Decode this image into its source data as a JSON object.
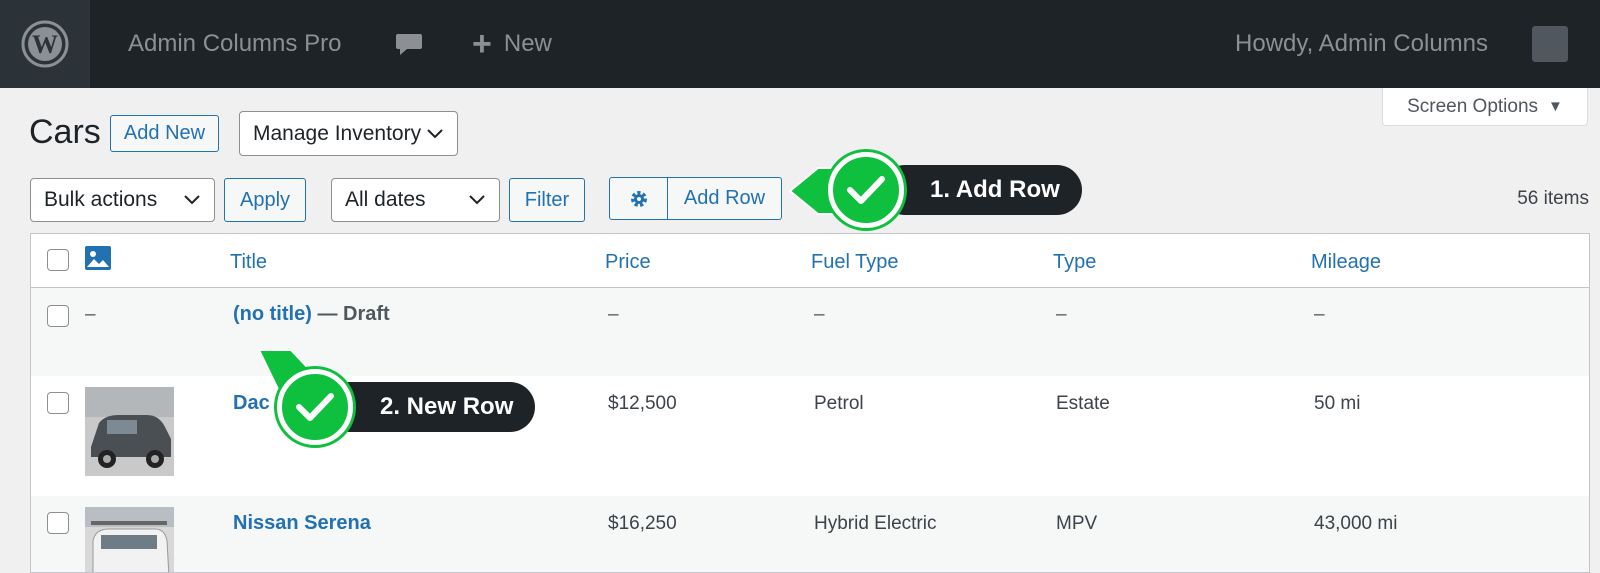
{
  "adminbar": {
    "site_name": "Admin Columns Pro",
    "new_label": "New",
    "howdy": "Howdy,  Admin Columns"
  },
  "screen_options": {
    "label": "Screen Options"
  },
  "page": {
    "title": "Cars",
    "add_new": "Add New",
    "manage_inventory": "Manage Inventory"
  },
  "toolbar": {
    "bulk_actions": "Bulk actions",
    "apply": "Apply",
    "all_dates": "All dates",
    "filter": "Filter",
    "add_row": "Add Row",
    "items_count": "56 items"
  },
  "table": {
    "headers": {
      "title": "Title",
      "price": "Price",
      "fuel_type": "Fuel Type",
      "type": "Type",
      "mileage": "Mileage"
    },
    "rows": [
      {
        "image": "–",
        "title": "(no title)",
        "state": "— Draft",
        "price": "–",
        "fuel_type": "–",
        "type": "–",
        "mileage": "–"
      },
      {
        "title": "Dac",
        "price": "$12,500",
        "fuel_type": "Petrol",
        "type": "Estate",
        "mileage": "50 mi"
      },
      {
        "title": "Nissan Serena",
        "price": "$16,250",
        "fuel_type": "Hybrid Electric",
        "type": "MPV",
        "mileage": "43,000 mi"
      }
    ]
  },
  "callouts": {
    "one": "1. Add Row",
    "two": "2. New Row"
  },
  "colors": {
    "accent": "#2271b1",
    "callout_green": "#0fbf3e",
    "adminbar": "#1d2327"
  }
}
